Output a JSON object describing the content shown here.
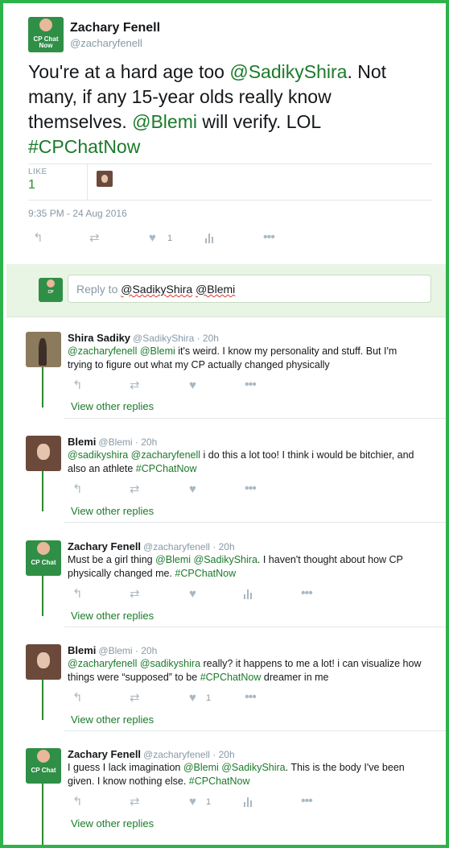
{
  "main_tweet": {
    "name": "Zachary Fenell",
    "handle": "@zacharyfenell",
    "text": {
      "part1": "You're at a hard age too ",
      "mention1": "@SadikyShira",
      "part2": ". Not many, if any 15-year olds really know themselves. ",
      "mention2": "@Blemi",
      "part3": " will verify. LOL ",
      "hashtag": "#CPChatNow"
    },
    "likes_label": "LIKE",
    "likes_count": "1",
    "timestamp": "9:35 PM - 24 Aug 2016",
    "like_action_count": "1",
    "avatar_text": "CP Chat Now"
  },
  "reply_box": {
    "placeholder_prefix": "Reply to ",
    "mention1": "@SadikyShira",
    "mention2": "@Blemi"
  },
  "replies": [
    {
      "name": "Shira Sadiky",
      "handle": "@SadikyShira · 20h",
      "mentions": "@zacharyfenell @Blemi",
      "text": " it's weird. I know my personality and stuff. But I'm trying to figure out what my CP actually changed physically",
      "hashtag": "",
      "suffix": "",
      "like_count": "",
      "view_other": "View other replies"
    },
    {
      "name": "Blemi",
      "handle": "@Blemi · 20h",
      "mentions": "@sadikyshira @zacharyfenell",
      "text": " i do this a lot too! I think i would be bitchier, and also an athlete ",
      "hashtag": "#CPChatNow",
      "suffix": "",
      "like_count": "",
      "view_other": "View other replies"
    },
    {
      "name": "Zachary Fenell",
      "handle": "@zacharyfenell · 20h",
      "mentions": "",
      "text_a": "Must be a girl thing ",
      "mention_a": "@Blemi @SadikyShira",
      "text": ". I haven't thought about how CP physically changed me. ",
      "hashtag": "#CPChatNow",
      "suffix": "",
      "like_count": "",
      "view_other": "View other replies"
    },
    {
      "name": "Blemi",
      "handle": "@Blemi · 20h",
      "mentions": "@zacharyfenell @sadikyshira",
      "text": " really? it happens to me a lot! i can visualize how things were “supposed” to be ",
      "hashtag": "#CPChatNow",
      "suffix": " dreamer in me",
      "like_count": "1",
      "view_other": "View other replies"
    },
    {
      "name": "Zachary Fenell",
      "handle": "@zacharyfenell · 20h",
      "mentions": "",
      "text_a": "I guess I lack imagination ",
      "mention_a": "@Blemi @SadikyShira",
      "text": ". This is the body I've been given. I know nothing else. ",
      "hashtag": "#CPChatNow",
      "suffix": "",
      "like_count": "1",
      "view_other": "View other replies"
    }
  ],
  "colors": {
    "frame_border": "#2db34a",
    "link_green": "#1b7a2a",
    "reply_box_bg": "#e8f5e4",
    "thread_line": "#2a8a2c"
  },
  "icons": [
    "reply-icon",
    "retweet-icon",
    "heart-icon",
    "analytics-icon",
    "more-icon"
  ]
}
